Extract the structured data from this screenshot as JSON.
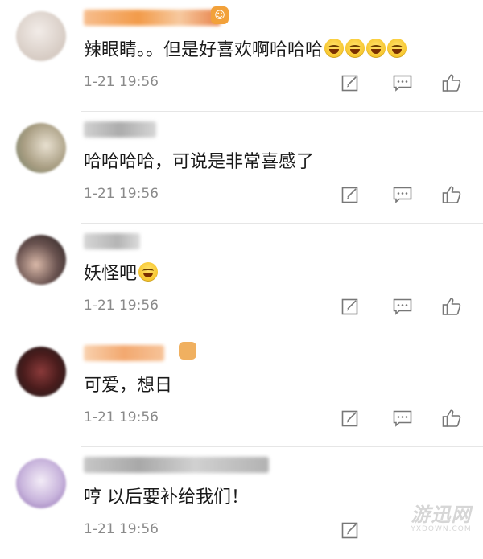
{
  "comments": [
    {
      "text": "辣眼睛。。但是好喜欢啊哈哈哈",
      "emoji_count": 4,
      "time": "1-21 19:56",
      "avatar": [
        "#e9e1dc",
        "#d9cfc6"
      ],
      "name_color": "#f08a2a",
      "badge_icon": "crown-face-icon"
    },
    {
      "text": "哈哈哈哈，可说是非常喜感了",
      "emoji_count": 0,
      "time": "1-21 19:56",
      "avatar": [
        "#c4b8a2",
        "#7b8a6e"
      ],
      "name_color": "#b0b0b0"
    },
    {
      "text": "妖怪吧",
      "emoji_count": 1,
      "time": "1-21 19:56",
      "avatar": [
        "#3a3030",
        "#c8a89a"
      ],
      "name_color": "#b8b8b8"
    },
    {
      "text": "可爱，想日",
      "emoji_count": 0,
      "time": "1-21 19:56",
      "avatar": [
        "#6e1f1f",
        "#2a2a2a"
      ],
      "name_color": "#f5a86a",
      "badge_icon": "orange-badge-icon"
    },
    {
      "text": "哼 以后要补给我们！",
      "emoji_count": 0,
      "time": "1-21 19:56",
      "avatar": [
        "#d8cce6",
        "#9a7ab8"
      ],
      "name_color": "#b8b8b8"
    }
  ],
  "icons": {
    "edit": "edit-icon",
    "message": "message-icon",
    "like": "thumbs-up-icon"
  },
  "watermark": {
    "main": "游迅网",
    "sub": "YXDOWN.COM"
  }
}
